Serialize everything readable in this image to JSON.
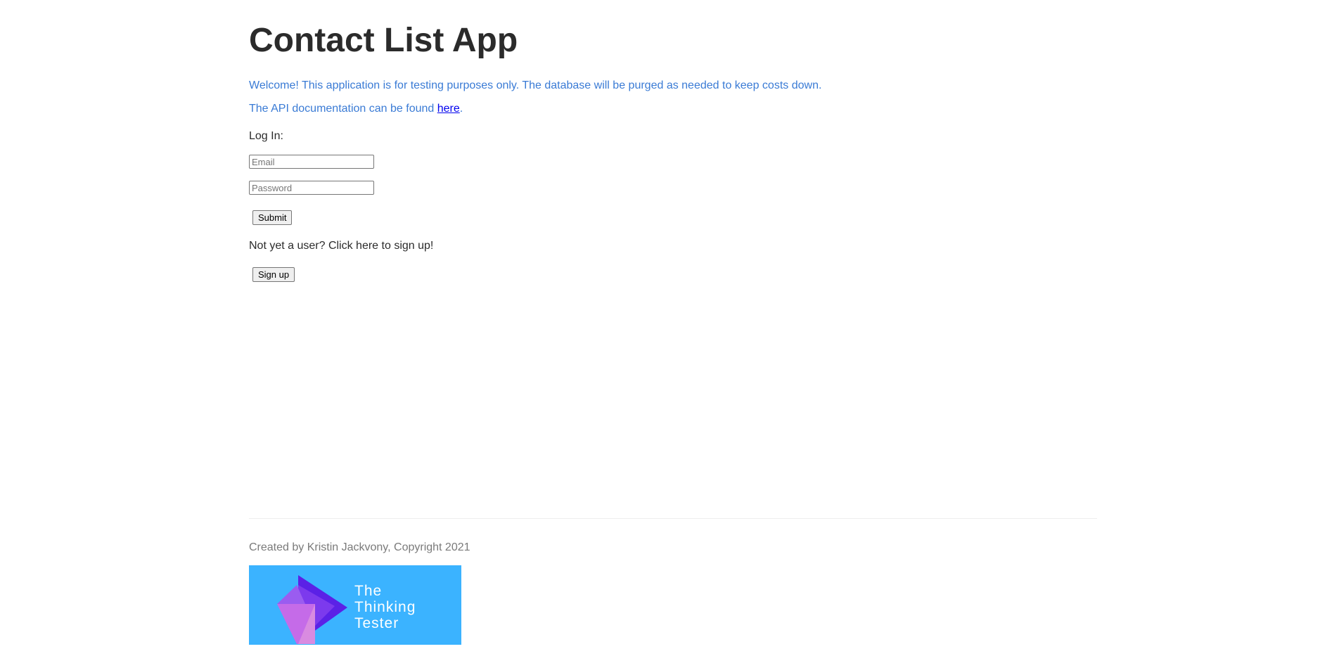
{
  "header": {
    "title": "Contact List App"
  },
  "intro": {
    "welcome": "Welcome! This application is for testing purposes only. The database will be purged as needed to keep costs down.",
    "api_prefix": "The API documentation can be found ",
    "api_link": "here",
    "api_suffix": "."
  },
  "login": {
    "label": "Log In:",
    "email_placeholder": "Email",
    "email_value": "",
    "password_placeholder": "Password",
    "password_value": "",
    "submit_label": "Submit"
  },
  "signup": {
    "prompt": "Not yet a user? Click here to sign up!",
    "button_label": "Sign up"
  },
  "footer": {
    "credit": "Created by Kristin Jackvony, Copyright 2021",
    "logo_lines": [
      "The",
      "Thinking",
      "Tester"
    ],
    "logo_bg_color": "#3bb3ff"
  },
  "colors": {
    "intro_text": "#3a7bd5",
    "link": "#0000ee",
    "heading": "#2b2b2b",
    "footer_text": "#7a7a7a"
  }
}
